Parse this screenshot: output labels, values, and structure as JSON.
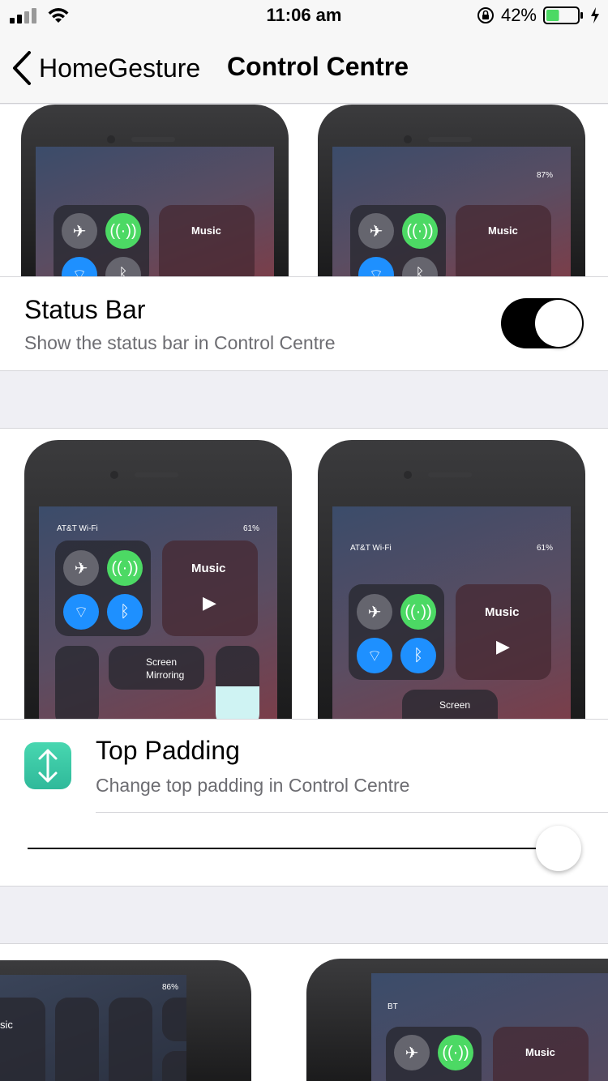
{
  "status_bar": {
    "time": "11:06 am",
    "battery_percent": "42%",
    "battery_level": 0.42,
    "icons": [
      "signal-icon",
      "wifi-icon",
      "orientation-lock-icon",
      "battery-icon",
      "charging-bolt-icon"
    ]
  },
  "nav": {
    "back_label": "HomeGesture",
    "title": "Control Centre"
  },
  "previews_top": {
    "right_status": "87%",
    "music_label": "Music"
  },
  "status_bar_setting": {
    "title": "Status Bar",
    "subtitle": "Show the status bar in Control Centre",
    "enabled": true
  },
  "previews_middle": {
    "carrier": "AT&T Wi-Fi",
    "battery": "61%",
    "music_label": "Music",
    "screen_mirroring_label": "Screen\nMirroring",
    "screen_label_right": "Screen"
  },
  "top_padding_setting": {
    "title": "Top Padding",
    "subtitle": "Change top padding in Control Centre",
    "slider_value": 1.0
  },
  "previews_bottom": {
    "left_battery": "86%",
    "left_music_partial": "sic",
    "right_carrier": "BT",
    "music_label": "Music"
  }
}
